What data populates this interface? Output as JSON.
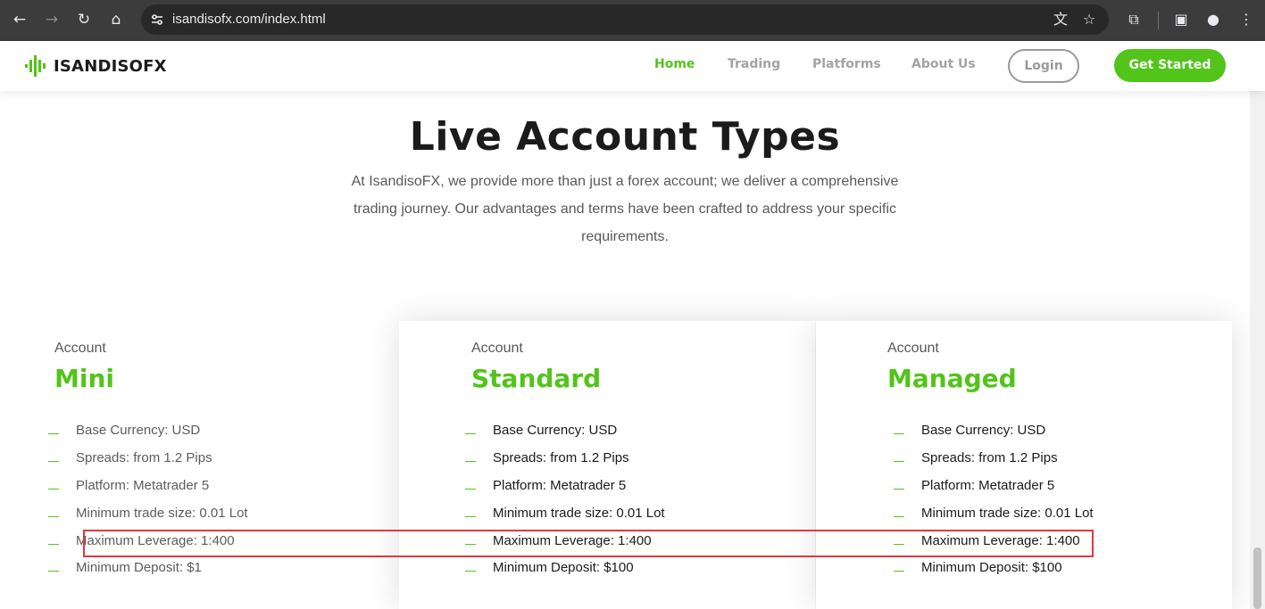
{
  "browser": {
    "url": "isandisofx.com/index.html",
    "back_icon": "←",
    "forward_icon": "→",
    "reload_icon": "↻",
    "home_icon": "⌂",
    "translate_icon": "文",
    "bookmark_icon": "☆",
    "extensions_icon": "⧉",
    "sidebar_icon": "▣",
    "profile_icon": "●",
    "menu_icon": "⋮"
  },
  "header": {
    "logo_text": "ISANDISOFX",
    "nav": [
      "Home",
      "Trading",
      "Platforms",
      "About Us"
    ],
    "login_label": "Login",
    "cta_label": "Get Started",
    "accent_color": "#52c41a"
  },
  "hero": {
    "title": "Live Account Types",
    "subtitle": "At IsandisoFX, we provide more than just a forex account; we deliver a comprehensive trading journey. Our advantages and terms have been crafted to address your specific requirements."
  },
  "accounts": [
    {
      "kicker": "Account",
      "name": "Mini",
      "features": [
        "Base Currency: USD",
        "Spreads: from 1.2 Pips",
        "Platform: Metatrader 5",
        "Minimum trade size: 0.01 Lot",
        "Maximum Leverage: 1:400",
        "Minimum Deposit: $1"
      ]
    },
    {
      "kicker": "Account",
      "name": "Standard",
      "features": [
        "Base Currency: USD",
        "Spreads: from 1.2 Pips",
        "Platform: Metatrader 5",
        "Minimum trade size: 0.01 Lot",
        "Maximum Leverage: 1:400",
        "Minimum Deposit: $100"
      ]
    },
    {
      "kicker": "Account",
      "name": "Managed",
      "features": [
        "Base Currency: USD",
        "Spreads: from 1.2 Pips",
        "Platform: Metatrader 5",
        "Minimum trade size: 0.01 Lot",
        "Maximum Leverage: 1:400",
        "Minimum Deposit: $100"
      ]
    }
  ]
}
